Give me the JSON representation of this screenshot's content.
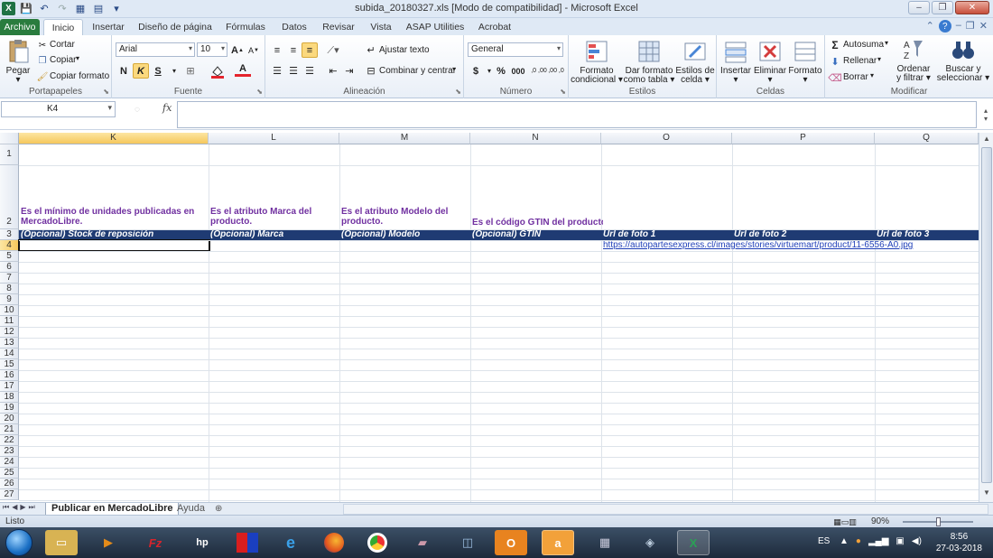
{
  "window": {
    "title": "subida_20180327.xls  [Modo de compatibilidad]  -  Microsoft Excel"
  },
  "tabs": [
    {
      "label": "Archivo"
    },
    {
      "label": "Inicio"
    },
    {
      "label": "Insertar"
    },
    {
      "label": "Diseño de página"
    },
    {
      "label": "Fórmulas"
    },
    {
      "label": "Datos"
    },
    {
      "label": "Revisar"
    },
    {
      "label": "Vista"
    },
    {
      "label": "ASAP Utilities"
    },
    {
      "label": "Acrobat"
    }
  ],
  "ribbon": {
    "clipboard": {
      "group": "Portapapeles",
      "paste": "Pegar",
      "cut": "Cortar",
      "copy": "Copiar",
      "format_painter": "Copiar formato"
    },
    "font": {
      "group": "Fuente",
      "name": "Arial",
      "size": "10",
      "bold": "N",
      "italic": "K",
      "underline": "S"
    },
    "alignment": {
      "group": "Alineación",
      "wrap": "Ajustar texto",
      "merge": "Combinar y centrar"
    },
    "number": {
      "group": "Número",
      "format": "General",
      "currency": "$",
      "percent": "%",
      "thousands": "000",
      "inc_decimal": ",0 ,00",
      "dec_decimal": ",00 ,0"
    },
    "styles": {
      "group": "Estilos",
      "cond_format_1": "Formato",
      "cond_format_2": "condicional",
      "table_1": "Dar formato",
      "table_2": "como tabla",
      "cell_styles_1": "Estilos de",
      "cell_styles_2": "celda"
    },
    "cells": {
      "group": "Celdas",
      "insert": "Insertar",
      "delete": "Eliminar",
      "format": "Formato"
    },
    "editing": {
      "group": "Modificar",
      "autosum": "Autosuma",
      "fill": "Rellenar",
      "clear": "Borrar",
      "sort_1": "Ordenar",
      "sort_2": "y filtrar",
      "find_1": "Buscar y",
      "find_2": "seleccionar"
    }
  },
  "formula_bar": {
    "name_box": "K4",
    "fx": "fx",
    "value": ""
  },
  "columns": [
    {
      "id": "K",
      "selected": true
    },
    {
      "id": "L"
    },
    {
      "id": "M"
    },
    {
      "id": "N"
    },
    {
      "id": "O"
    },
    {
      "id": "P"
    },
    {
      "id": "Q"
    }
  ],
  "rows": [
    "1",
    "2",
    "3",
    "4",
    "5",
    "6",
    "7",
    "8",
    "9",
    "10",
    "11",
    "12",
    "13",
    "14",
    "15",
    "16",
    "17",
    "18",
    "19",
    "20",
    "21",
    "22",
    "23",
    "24",
    "25",
    "26",
    "27"
  ],
  "cells": {
    "K2": "Es el mínimo de unidades publicadas en MercadoLibre.",
    "L2": "Es el atributo Marca del producto.",
    "M2": "Es el atributo Modelo del producto.",
    "N2": "Es el código GTIN del producto.",
    "K3": "(Opcional) Stock de reposición",
    "L3": "(Opcional) Marca",
    "M3": "(Opcional) Modelo",
    "N3": "(Opcional) GTIN",
    "O3": "Url de foto 1",
    "P3": "Url de foto 2",
    "Q3": "Url de foto 3",
    "O4": "https://autopartesexpress.cl/images/stories/virtuemart/product/11-6556-A0.jpg"
  },
  "sheets": [
    {
      "name": "Publicar en MercadoLibre",
      "active": true
    },
    {
      "name": "Ayuda"
    }
  ],
  "status": {
    "ready": "Listo",
    "zoom": "90%"
  },
  "taskbar": {
    "lang": "ES",
    "time": "8:56",
    "date": "27-03-2018"
  },
  "colors": {
    "header_band": "#1f3b73",
    "description_text": "#7030a0",
    "link": "#1f3fb8"
  }
}
